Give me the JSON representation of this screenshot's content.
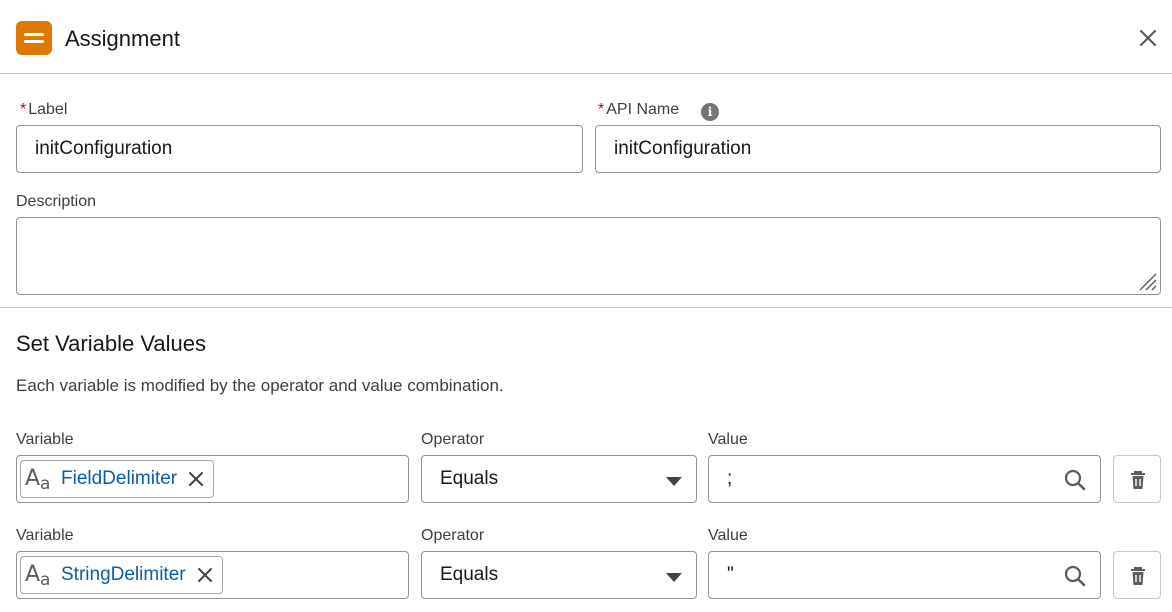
{
  "header": {
    "title": "Assignment",
    "icon": "assignment-icon",
    "accent_color": "#dd7a01"
  },
  "fields": {
    "label": {
      "label": "Label",
      "required_mark": "*",
      "value": "initConfiguration"
    },
    "api_name": {
      "label": "API Name",
      "required_mark": "*",
      "value": "initConfiguration",
      "info_glyph": "i"
    },
    "description": {
      "label": "Description",
      "value": ""
    }
  },
  "section": {
    "title": "Set Variable Values",
    "description": "Each variable is modified by the operator and value combination."
  },
  "rows": [
    {
      "variable_label": "Variable",
      "variable_value": "FieldDelimiter",
      "type_icon_upper": "A",
      "type_icon_lower": "a",
      "operator_label": "Operator",
      "operator_value": "Equals",
      "value_label": "Value",
      "value": ";"
    },
    {
      "variable_label": "Variable",
      "variable_value": "StringDelimiter",
      "type_icon_upper": "A",
      "type_icon_lower": "a",
      "operator_label": "Operator",
      "operator_value": "Equals",
      "value_label": "Value",
      "value": "\""
    }
  ],
  "colors": {
    "link": "#0b5cab",
    "required": "#ba0517",
    "border": "#939393"
  }
}
